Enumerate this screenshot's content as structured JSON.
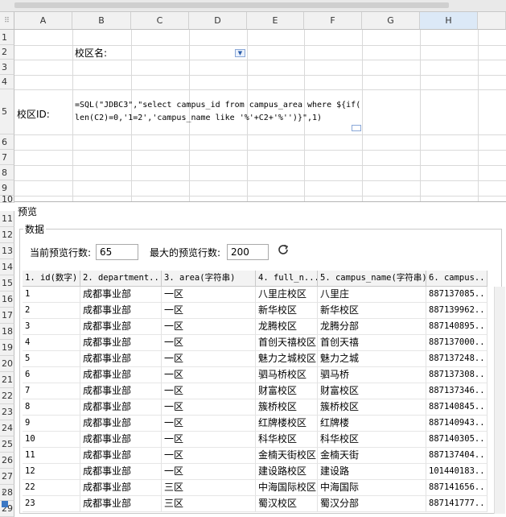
{
  "sheet": {
    "columns": [
      "A",
      "B",
      "C",
      "D",
      "E",
      "F",
      "G",
      "H"
    ],
    "selected_column": "H",
    "row_numbers": [
      "1",
      "2",
      "3",
      "4",
      "5",
      "6",
      "7",
      "8",
      "9",
      "10"
    ],
    "left_row_numbers": [
      "11",
      "12",
      "13",
      "14",
      "15",
      "16",
      "17",
      "18",
      "19",
      "20",
      "21",
      "22",
      "23",
      "24",
      "25",
      "26",
      "27",
      "28",
      "29"
    ],
    "cells": {
      "b2": "校区名:",
      "a5": "校区ID:",
      "formula_line1": "=SQL(\"JDBC3\",\"select campus_id from campus_area where ${if(",
      "formula_line2": "len(C2)=0,'1=2','campus_name like '%'+C2+'%'')}\",1)"
    }
  },
  "preview": {
    "title": "预览",
    "group_label": "数据",
    "current_rows_label": "当前预览行数:",
    "current_rows_value": "65",
    "max_rows_label": "最大的预览行数:",
    "max_rows_value": "200",
    "refresh_icon": "refresh-icon",
    "headers": [
      "1. id(数字)",
      "2. department...",
      "3. area(字符串)",
      "4. full_n...",
      "5. campus_name(字符串)",
      "6. campus..."
    ],
    "rows": [
      [
        "1",
        "成都事业部",
        "一区",
        "八里庄校区",
        "八里庄",
        "887137085..."
      ],
      [
        "2",
        "成都事业部",
        "一区",
        "新华校区",
        "新华校区",
        "887139962..."
      ],
      [
        "3",
        "成都事业部",
        "一区",
        "龙腾校区",
        "龙腾分部",
        "887140895..."
      ],
      [
        "4",
        "成都事业部",
        "一区",
        "首创天禧校区",
        "首创天禧",
        "887137000..."
      ],
      [
        "5",
        "成都事业部",
        "一区",
        "魅力之城校区",
        "魅力之城",
        "887137248..."
      ],
      [
        "6",
        "成都事业部",
        "一区",
        "驷马桥校区",
        "驷马桥",
        "887137308..."
      ],
      [
        "7",
        "成都事业部",
        "一区",
        "财富校区",
        "财富校区",
        "887137346..."
      ],
      [
        "8",
        "成都事业部",
        "一区",
        "簇桥校区",
        "簇桥校区",
        "887140845..."
      ],
      [
        "9",
        "成都事业部",
        "一区",
        "红牌楼校区",
        "红牌楼",
        "887140943..."
      ],
      [
        "10",
        "成都事业部",
        "一区",
        "科华校区",
        "科华校区",
        "887140305..."
      ],
      [
        "11",
        "成都事业部",
        "一区",
        "金楠天街校区",
        "金楠天街",
        "887137404..."
      ],
      [
        "12",
        "成都事业部",
        "一区",
        "建设路校区",
        "建设路",
        "101440183..."
      ],
      [
        "22",
        "成都事业部",
        "三区",
        "中海国际校区",
        "中海国际",
        "887141656..."
      ],
      [
        "23",
        "成都事业部",
        "三区",
        "蜀汉校区",
        "蜀汉分部",
        "887141777..."
      ]
    ]
  }
}
